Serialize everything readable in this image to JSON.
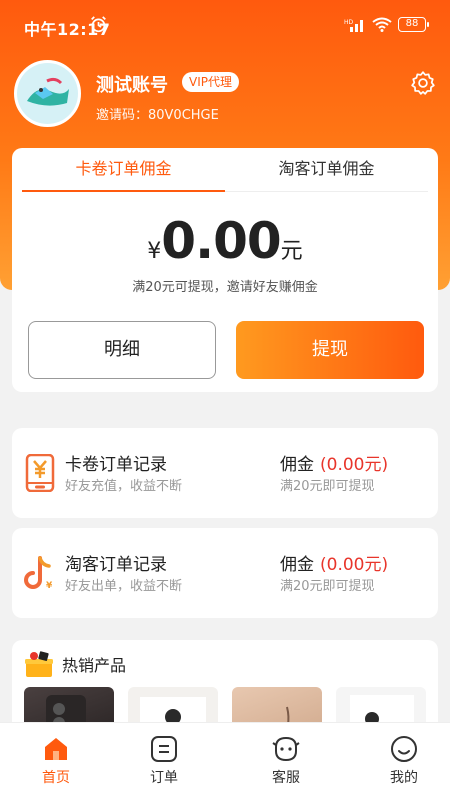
{
  "status": {
    "time": "中午12:17",
    "battery": "88"
  },
  "profile": {
    "name": "测试账号",
    "badge": "VIP代理",
    "invite": "邀请码：80V0CHGE"
  },
  "tabs": [
    {
      "label": "卡卷订单佣金"
    },
    {
      "label": "淘客订单佣金"
    }
  ],
  "amount": {
    "currency": "¥",
    "value": "0.00",
    "unit": "元",
    "hint": "满20元可提现，邀请好友赚佣金"
  },
  "buttons": {
    "detail": "明细",
    "withdraw": "提现"
  },
  "records": [
    {
      "title": "卡卷订单记录",
      "sub": "好友充值，收益不断",
      "label": "佣金",
      "value": "(0.00元)",
      "hint": "满20元即可提现"
    },
    {
      "title": "淘客订单记录",
      "sub": "好友出单，收益不断",
      "label": "佣金",
      "value": "(0.00元)",
      "hint": "满20元即可提现"
    }
  ],
  "hot": {
    "title": "热销产品"
  },
  "nav": [
    {
      "label": "首页",
      "icon": "home-icon"
    },
    {
      "label": "订单",
      "icon": "order-icon"
    },
    {
      "label": "客服",
      "icon": "service-icon"
    },
    {
      "label": "我的",
      "icon": "profile-icon"
    }
  ],
  "colors": {
    "accent": "#ff5a0e",
    "money": "#e8352b"
  }
}
